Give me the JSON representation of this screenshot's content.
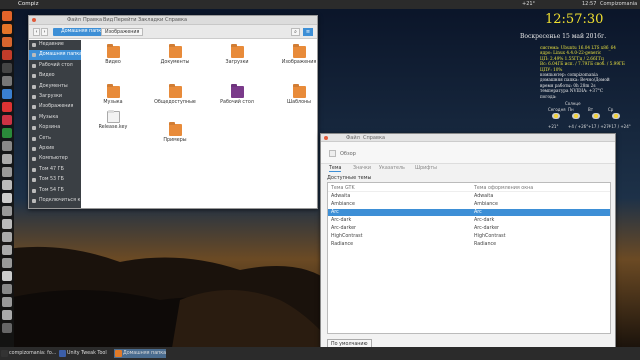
{
  "topbar": {
    "title": "Compiz",
    "indicators": {
      "temp": "+21°",
      "time": "12:57",
      "user": "Compizomania"
    }
  },
  "taskbar": {
    "items": [
      {
        "label": "compizomania: fo...",
        "color": "#333"
      },
      {
        "label": "Unity Tweak Tool",
        "color": "#3b5ea8"
      },
      {
        "label": "Домашняя папка",
        "color": "#e07a28",
        "active": true
      }
    ]
  },
  "launcher": {
    "icons": [
      {
        "name": "dash",
        "color": "#e2642a"
      },
      {
        "name": "firefox",
        "color": "#e47428"
      },
      {
        "name": "files",
        "color": "#d8662e"
      },
      {
        "name": "software",
        "color": "#c33c2a"
      },
      {
        "name": "terminal",
        "color": "#444"
      },
      {
        "name": "settings",
        "color": "#777"
      },
      {
        "name": "app",
        "color": "#3a7fd0"
      },
      {
        "name": "app2",
        "color": "#d33"
      },
      {
        "name": "app3",
        "color": "#c34"
      },
      {
        "name": "app4",
        "color": "#2a8a3a"
      },
      {
        "name": "app5",
        "color": "#888"
      },
      {
        "name": "app6",
        "color": "#aaa"
      },
      {
        "name": "app7",
        "color": "#999"
      },
      {
        "name": "app8",
        "color": "#bbb"
      },
      {
        "name": "app9",
        "color": "#ccc"
      },
      {
        "name": "app10",
        "color": "#999"
      },
      {
        "name": "app11",
        "color": "#bbb"
      },
      {
        "name": "app12",
        "color": "#aaa"
      },
      {
        "name": "app13",
        "color": "#aaa"
      },
      {
        "name": "app14",
        "color": "#999"
      },
      {
        "name": "app15",
        "color": "#ccc"
      },
      {
        "name": "app16",
        "color": "#888"
      },
      {
        "name": "app17",
        "color": "#999"
      },
      {
        "name": "app18",
        "color": "#aaa"
      },
      {
        "name": "trash",
        "color": "#666"
      }
    ]
  },
  "fm": {
    "menu": [
      "Файл",
      "Правка",
      "Вид",
      "Перейти",
      "Закладки",
      "Справка"
    ],
    "crumbs": {
      "home": "Домашняя папка",
      "pictures": "Изображения"
    },
    "sidebar": [
      {
        "label": "Недавние"
      },
      {
        "label": "Домашняя папка",
        "selected": true
      },
      {
        "label": "Рабочий стол"
      },
      {
        "label": "Видео"
      },
      {
        "label": "Документы"
      },
      {
        "label": "Загрузки"
      },
      {
        "label": "Изображения"
      },
      {
        "label": "Музыка"
      },
      {
        "label": "Корзина"
      },
      {
        "label": "Сеть"
      },
      {
        "label": "Архив"
      },
      {
        "label": "Компьютер"
      },
      {
        "label": "Том 47 ГБ"
      },
      {
        "label": "Том 53 ГБ"
      },
      {
        "label": "Том 54 ГБ"
      },
      {
        "label": "Подключиться к серверу"
      }
    ],
    "items": [
      {
        "label": "Видео",
        "color": "#e88b3a"
      },
      {
        "label": "Документы",
        "color": "#e88b3a"
      },
      {
        "label": "Загрузки",
        "color": "#e88b3a"
      },
      {
        "label": "Изображения",
        "color": "#e88b3a"
      },
      {
        "label": "Музыка",
        "color": "#e88b3a"
      },
      {
        "label": "Общедоступные",
        "color": "#e88b3a"
      },
      {
        "label": "Рабочий стол",
        "color": "#7a3a8a"
      },
      {
        "label": "Шаблоны",
        "color": "#e88b3a"
      },
      {
        "label": "Release.key",
        "color": "#f3f3f3"
      },
      {
        "label": "Примеры",
        "color": "#e88b3a"
      }
    ]
  },
  "tw": {
    "menu": [
      "Файл",
      "Справка"
    ],
    "overview": "Обзор",
    "tabs": [
      "Тема",
      "Значки",
      "Указатель",
      "Шрифты"
    ],
    "available": "Доступные темы",
    "col_gtk": "Тема GTK",
    "col_wm": "Тема оформления окна",
    "rows": [
      [
        "Adwaita",
        "Adwaita"
      ],
      [
        "Ambiance",
        "Ambiance"
      ],
      [
        "Arc",
        "Arc"
      ],
      [
        "Arc-dark",
        "Arc-dark"
      ],
      [
        "Arc-darker",
        "Arc-darker"
      ],
      [
        "HighContrast",
        "HighContrast"
      ],
      [
        "Radiance",
        "Radiance"
      ]
    ],
    "selected": 2,
    "default_btn": "По умолчанию"
  },
  "conky": {
    "time": "12:57:30",
    "date": "Воскресенье 15 май 2016г.",
    "lines": [
      "система: Ubuntu 16.04 LTS x86_64",
      "ядро: Linux 4.4.0-22-generic",
      "ЦП: 2.49% 1.55ГГц / 2.66ГГц",
      "Вс: 6.04ГБ исп. / 7.79ГБ своб. / 5.99ГБ",
      "ЦПУ: 10%",
      "компьютер: compizomania",
      "домашняя папка: Вечно/Домой",
      "время работы: 0h 28m 2s",
      "температура NVIDIA: +37°C",
      "погода:"
    ],
    "weather": {
      "now": "Солнце",
      "temps": [
        "+21°",
        "+4 / +26°",
        "+17 / +27°",
        "+17 / +24°"
      ],
      "days": [
        "Сегодня",
        "Пн",
        "Вт",
        "Ср"
      ]
    }
  }
}
